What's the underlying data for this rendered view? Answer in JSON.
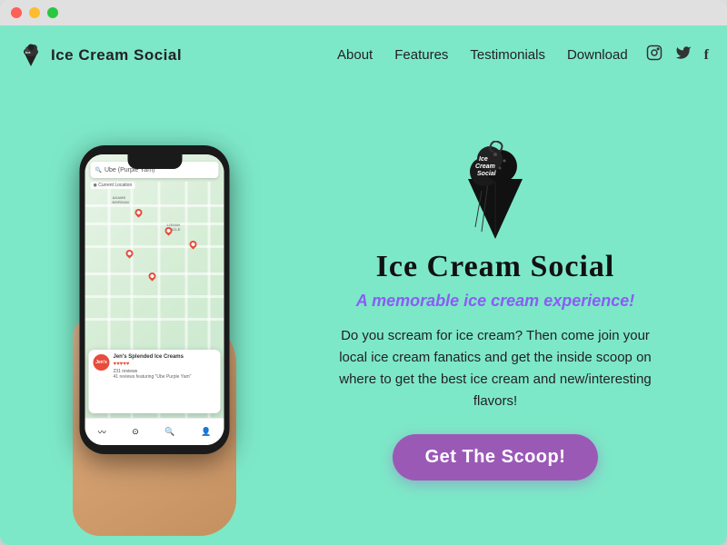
{
  "window": {
    "title": "Ice Cream Social"
  },
  "navbar": {
    "brand": "Ice  Cream  Social",
    "links": [
      {
        "label": "About",
        "id": "about"
      },
      {
        "label": "Features",
        "id": "features"
      },
      {
        "label": "Testimonials",
        "id": "testimonials"
      },
      {
        "label": "Download",
        "id": "download"
      }
    ],
    "socials": [
      {
        "icon": "📷",
        "name": "instagram-icon"
      },
      {
        "icon": "🐦",
        "name": "twitter-icon"
      },
      {
        "icon": "f",
        "name": "facebook-icon"
      }
    ]
  },
  "hero": {
    "title": "Ice  Cream  Social",
    "subtitle": "A memorable ice cream experience!",
    "description": "Do you scream for ice cream? Then come join your local ice cream fanatics and get the inside scoop on where to get the best ice cream and new/interesting flavors!",
    "cta_label": "Get The Scoop!"
  },
  "phone": {
    "search_placeholder": "Ube (Purple Yam)",
    "location_label": "Current Location",
    "card_name": "Jen's Splended Ice Creams",
    "card_stars": "♥♥♥♥♥",
    "card_reviews": "231 reviews",
    "card_desc": "41 reviews featuring \"Ube Purple Yam\""
  }
}
